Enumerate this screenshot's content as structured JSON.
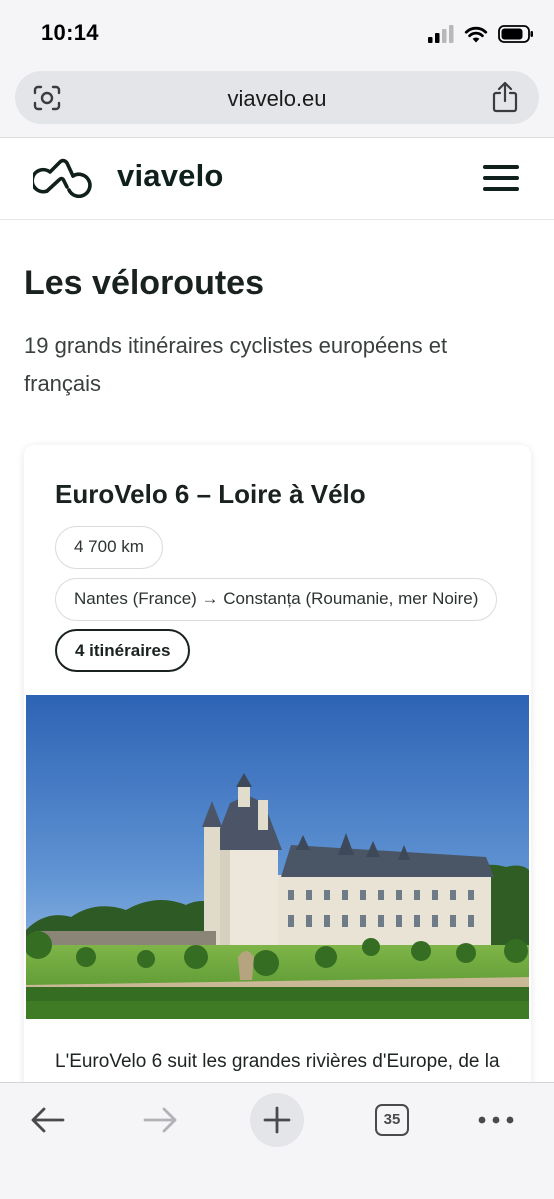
{
  "status_bar": {
    "time": "10:14"
  },
  "browser": {
    "url": "viavelo.eu",
    "tab_count": "35"
  },
  "site": {
    "logo_text": "viavelo"
  },
  "page": {
    "title": "Les véloroutes",
    "subtitle": "19 grands itinéraires cyclistes européens et français"
  },
  "card": {
    "title": "EuroVelo 6 – Loire à Vélo",
    "distance": "4 700 km",
    "route": "Nantes (France) → Constanța (Roumanie, mer Noire)",
    "itineraries": "4 itinéraires",
    "description": "L'EuroVelo 6 suit les grandes rivières d'Europe, de la"
  },
  "icons": {
    "status": [
      "signal-icon",
      "wifi-icon",
      "battery-icon"
    ],
    "browser": [
      "lens-icon",
      "share-icon",
      "back-icon",
      "forward-icon",
      "new-tab-icon",
      "tabs-icon",
      "more-icon"
    ],
    "site": [
      "bike-logo-icon",
      "hamburger-menu-icon"
    ]
  },
  "colors": {
    "brand_dark": "#0f1f1b",
    "browser_chrome": "#f5f5f7",
    "url_pill": "#e3e5e8"
  }
}
